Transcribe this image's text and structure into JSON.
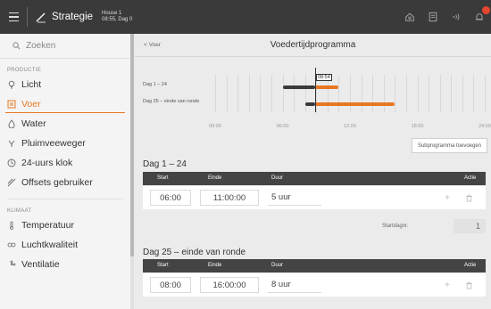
{
  "topbar": {
    "app_title": "Strategie",
    "house_name": "House 1",
    "house_time": "08:55, Dag 0",
    "notification_count": ""
  },
  "sidebar": {
    "search_placeholder": "Zoeken",
    "sections": [
      {
        "title": "PRODUCTIE",
        "items": [
          {
            "label": "Licht",
            "icon": "bulb-icon",
            "active": false
          },
          {
            "label": "Voer",
            "icon": "feeder-icon",
            "active": true
          },
          {
            "label": "Water",
            "icon": "drop-icon",
            "active": false
          },
          {
            "label": "Pluimveeweger",
            "icon": "scale-icon",
            "active": false
          },
          {
            "label": "24-uurs klok",
            "icon": "clock-icon",
            "active": false
          },
          {
            "label": "Offsets gebruiker",
            "icon": "offset-icon",
            "active": false
          }
        ]
      },
      {
        "title": "KLIMAAT",
        "items": [
          {
            "label": "Temperatuur",
            "icon": "thermometer-icon",
            "active": false
          },
          {
            "label": "Luchtkwaliteit",
            "icon": "co2-icon",
            "active": false
          },
          {
            "label": "Ventilatie",
            "icon": "fan-icon",
            "active": false
          }
        ]
      }
    ]
  },
  "main": {
    "back_label": "< Voer",
    "page_title": "Voedertijdprogramma",
    "timeline": {
      "row1_label": "Dag 1 – 24",
      "row2_label": "Dag 25 – einde van ronde",
      "ticks": [
        "00:00",
        "06:00",
        "12:00",
        "18:00",
        "24:00"
      ],
      "now_label": "08:54",
      "now_hour": 8.9,
      "colors": {
        "dark": "#3a3a3a",
        "accent": "#e87722"
      }
    },
    "add_subprogram_label": "Subprogramma toevoegen",
    "table_headers": {
      "start": "Start",
      "end": "Einde",
      "duration": "Duur",
      "action": "Actie"
    },
    "programs": [
      {
        "title": "Dag 1 – 24",
        "start": "06:00",
        "end": "11:00:00",
        "duration": "5 uur"
      },
      {
        "title": "Dag 25 – einde van ronde",
        "start": "08:00",
        "end": "16:00:00",
        "duration": "8 uur"
      }
    ],
    "start_day_label": "Startdagnr.",
    "start_day_value": "1"
  }
}
